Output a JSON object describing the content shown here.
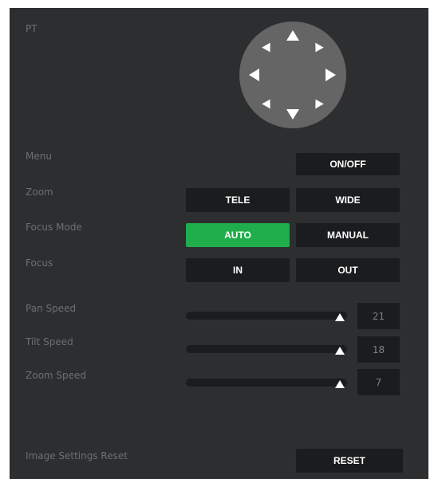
{
  "pt": {
    "label": "PT",
    "icons": {
      "up": "arrow-up-icon",
      "down": "arrow-down-icon",
      "left": "arrow-left-icon",
      "right": "arrow-right-icon",
      "up_left": "arrow-up-left-icon",
      "up_right": "arrow-up-right-icon",
      "down_left": "arrow-down-left-icon",
      "down_right": "arrow-down-right-icon"
    }
  },
  "menu": {
    "label": "Menu",
    "button": "ON/OFF"
  },
  "zoom": {
    "label": "Zoom",
    "tele": "TELE",
    "wide": "WIDE"
  },
  "focus_mode": {
    "label": "Focus Mode",
    "auto": "AUTO",
    "manual": "MANUAL",
    "selected": "AUTO"
  },
  "focus": {
    "label": "Focus",
    "in": "IN",
    "out": "OUT"
  },
  "speeds": {
    "pan": {
      "label": "Pan Speed",
      "value": "21"
    },
    "tilt": {
      "label": "Tilt Speed",
      "value": "18"
    },
    "zoom": {
      "label": "Zoom Speed",
      "value": "7"
    }
  },
  "image_reset": {
    "label": "Image Settings Reset",
    "button": "RESET"
  },
  "colors": {
    "panel_bg": "#2c2e30",
    "button_bg": "#1b1c1e",
    "active_green": "#1fae4b",
    "joystick": "#656565",
    "label_text": "#6c7074"
  }
}
